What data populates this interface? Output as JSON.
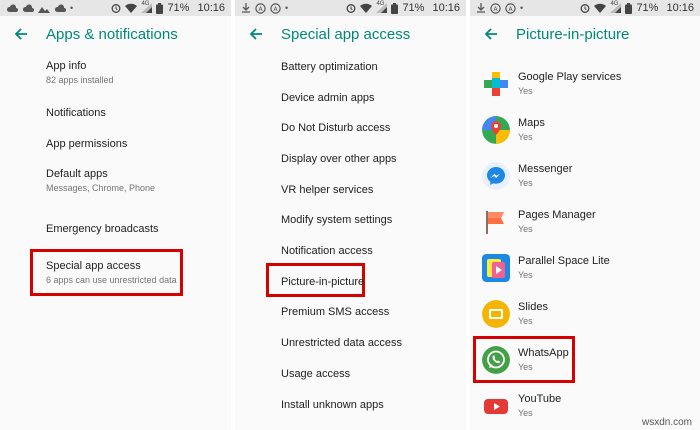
{
  "status": {
    "signal_label": "4G",
    "battery": "71%",
    "time": "10:16"
  },
  "panels": {
    "apps": {
      "title": "Apps & notifications",
      "items": [
        {
          "title": "App info",
          "sub": "82 apps installed"
        },
        {
          "title": "Notifications",
          "sub": ""
        },
        {
          "title": "App permissions",
          "sub": ""
        },
        {
          "title": "Default apps",
          "sub": "Messages, Chrome, Phone"
        },
        {
          "title": "Emergency broadcasts",
          "sub": ""
        },
        {
          "title": "Special app access",
          "sub": "6 apps can use unrestricted data"
        }
      ]
    },
    "special": {
      "title": "Special app access",
      "items": [
        "Battery optimization",
        "Device admin apps",
        "Do Not Disturb access",
        "Display over other apps",
        "VR helper services",
        "Modify system settings",
        "Notification access",
        "Picture-in-picture",
        "Premium SMS access",
        "Unrestricted data access",
        "Usage access",
        "Install unknown apps"
      ]
    },
    "pip": {
      "title": "Picture-in-picture",
      "apps": [
        {
          "name": "Google Play services",
          "status": "Yes",
          "icon": "google-play-services-icon"
        },
        {
          "name": "Maps",
          "status": "Yes",
          "icon": "maps-icon"
        },
        {
          "name": "Messenger",
          "status": "Yes",
          "icon": "messenger-icon"
        },
        {
          "name": "Pages Manager",
          "status": "Yes",
          "icon": "pages-manager-icon"
        },
        {
          "name": "Parallel Space Lite",
          "status": "Yes",
          "icon": "parallel-space-icon"
        },
        {
          "name": "Slides",
          "status": "Yes",
          "icon": "slides-icon"
        },
        {
          "name": "WhatsApp",
          "status": "Yes",
          "icon": "whatsapp-icon"
        },
        {
          "name": "YouTube",
          "status": "Yes",
          "icon": "youtube-icon"
        }
      ]
    }
  },
  "colors": {
    "accent": "#00897b",
    "highlight": "#d50000",
    "statusbar": "#e6e6e6"
  },
  "watermark": "wsxdn.com"
}
